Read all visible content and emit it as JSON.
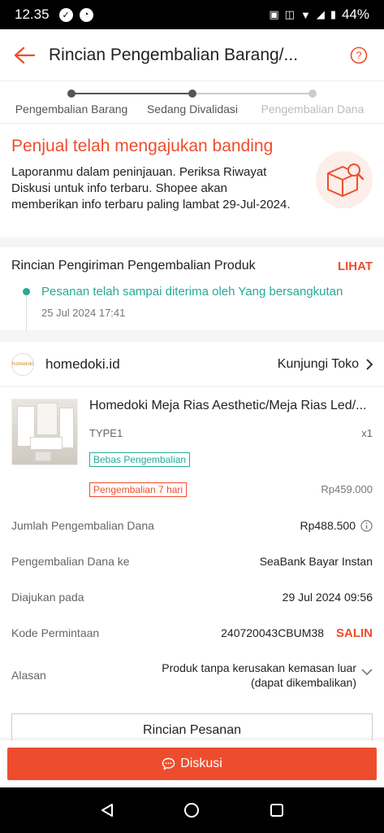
{
  "status_bar": {
    "time": "12.35",
    "battery": "44%"
  },
  "header": {
    "title": "Rincian Pengembalian Barang/..."
  },
  "stepper": {
    "steps": [
      {
        "label": "Pengembalian Barang",
        "state": "done"
      },
      {
        "label": "Sedang Divalidasi",
        "state": "current"
      },
      {
        "label": "Pengembalian Dana",
        "state": "pending"
      }
    ]
  },
  "status": {
    "title": "Penjual telah mengajukan banding",
    "description": "Laporanmu dalam peninjauan. Periksa Riwayat Diskusi untuk info terbaru. Shopee akan memberikan info terbaru paling lambat 29-Jul-2024."
  },
  "shipping": {
    "title": "Rincian Pengiriman Pengembalian Produk",
    "link": "LIHAT",
    "event_text": "Pesanan telah sampai diterima oleh Yang bersangkutan",
    "event_time": "25 Jul 2024 17:41"
  },
  "shop": {
    "logo_text": "homedoki",
    "name": "homedoki.id",
    "visit_label": "Kunjungi Toko"
  },
  "product": {
    "name": "Homedoki Meja Rias Aesthetic/Meja Rias Led/...",
    "variant": "TYPE1",
    "qty": "x1",
    "tag_free_return": "Bebas Pengembalian",
    "tag_return_days": "Pengembalian 7 hari",
    "price": "Rp459.000"
  },
  "details": {
    "refund_amount_label": "Jumlah Pengembalian Dana",
    "refund_amount_value": "Rp488.500",
    "refund_to_label": "Pengembalian Dana ke",
    "refund_to_value": "SeaBank Bayar Instan",
    "submitted_label": "Diajukan pada",
    "submitted_value": "29 Jul 2024 09:56",
    "code_label": "Kode Permintaan",
    "code_value": "240720043CBUM38",
    "copy_label": "SALIN",
    "reason_label": "Alasan",
    "reason_value": "Produk tanpa kerusakan kemasan luar (dapat dikembalikan)"
  },
  "order_details_button": "Rincian Pesanan",
  "discussion_button": "Diskusi",
  "colors": {
    "accent": "#ee4d2d",
    "success": "#26aa99"
  }
}
